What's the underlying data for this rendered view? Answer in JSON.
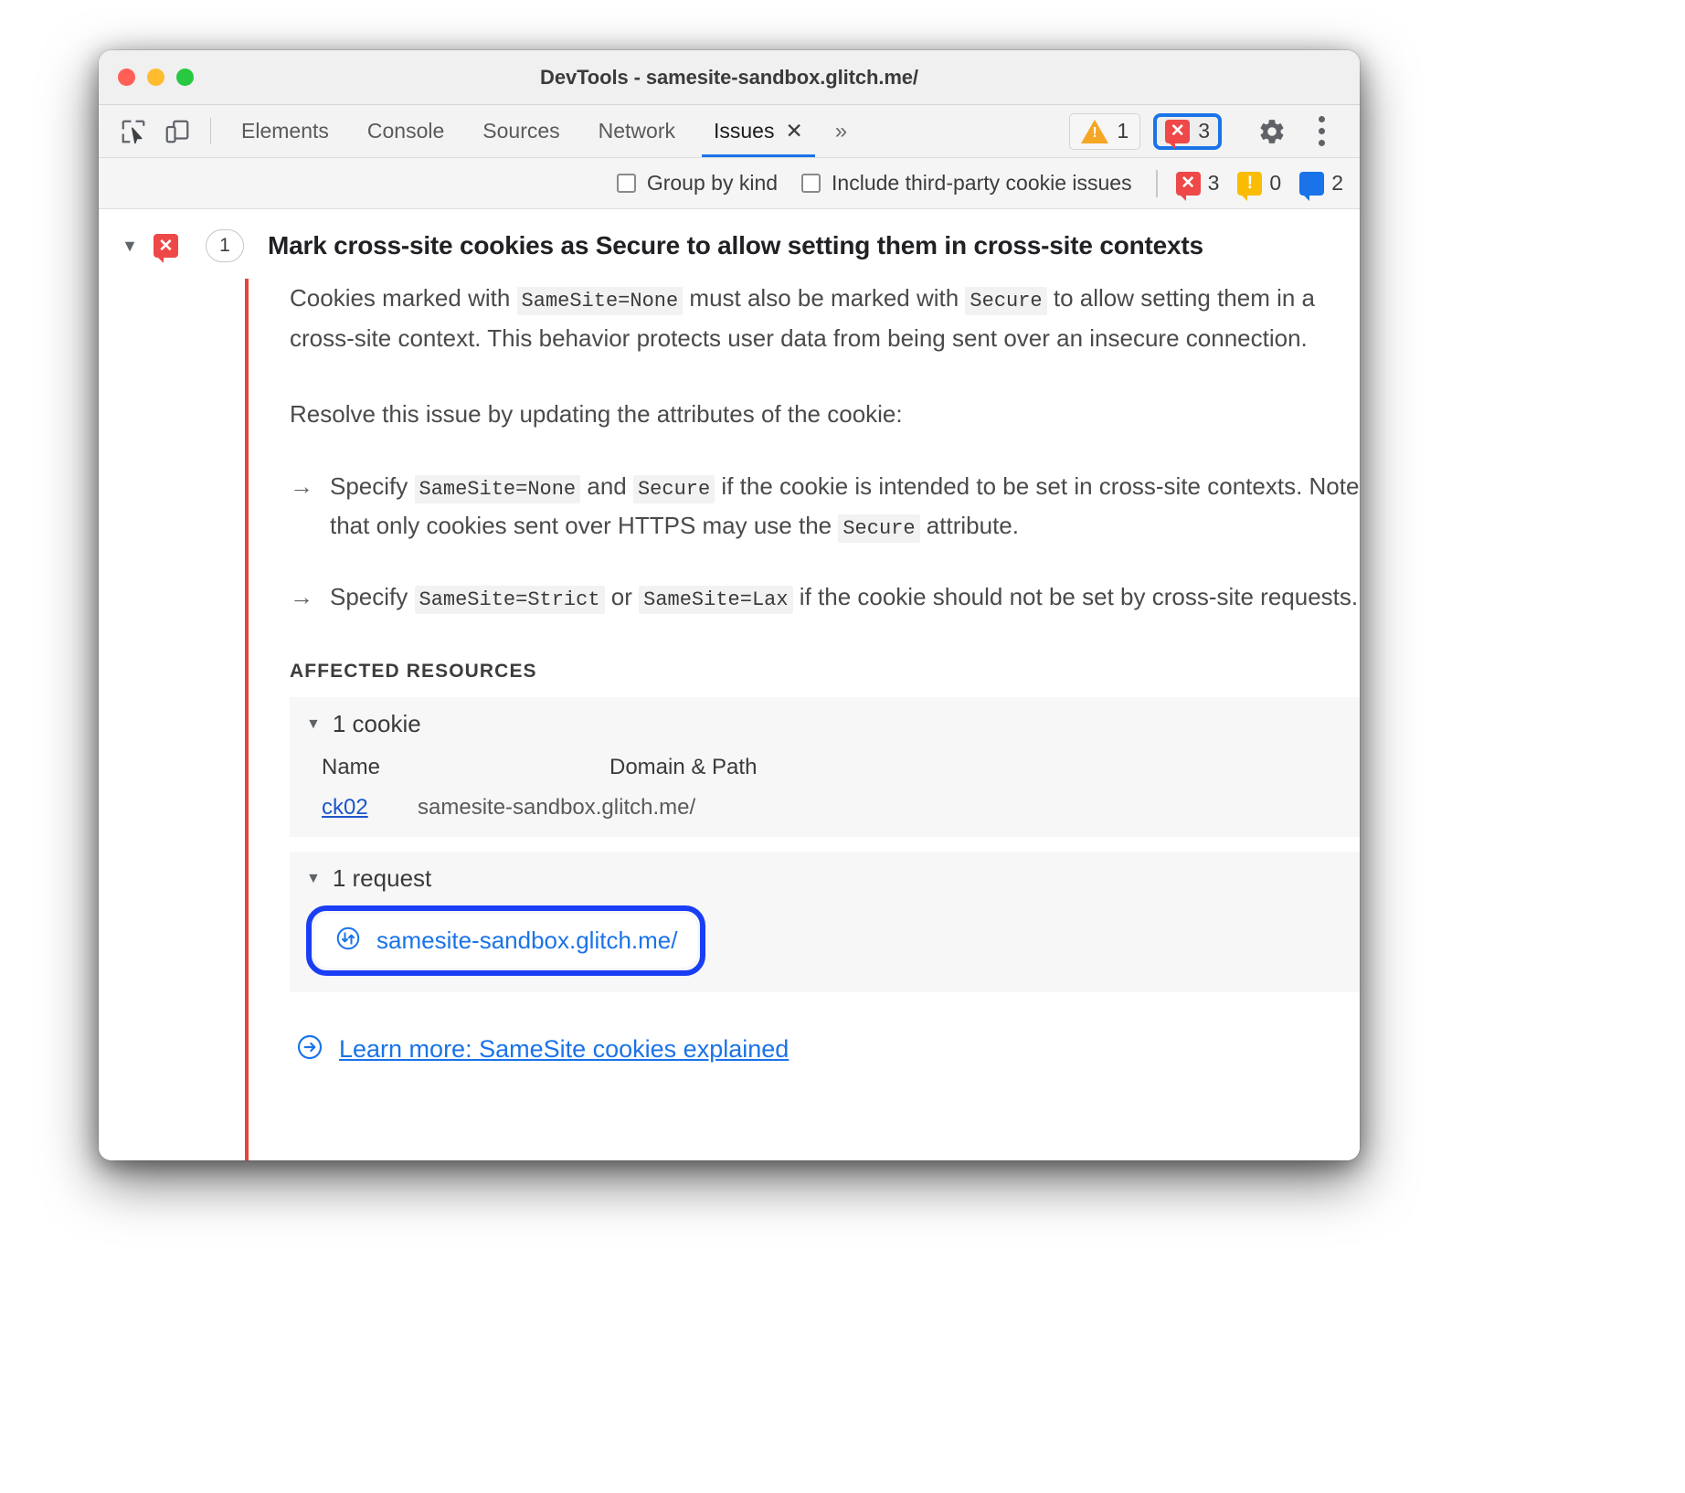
{
  "window": {
    "title": "DevTools - samesite-sandbox.glitch.me/",
    "traffic_lights": [
      "close",
      "minimize",
      "zoom"
    ]
  },
  "toolbar": {
    "inspect_icon": "inspect-element-icon",
    "device_icon": "device-toolbar-icon",
    "tabs": [
      {
        "label": "Elements",
        "active": false,
        "closable": false
      },
      {
        "label": "Console",
        "active": false,
        "closable": false
      },
      {
        "label": "Sources",
        "active": false,
        "closable": false
      },
      {
        "label": "Network",
        "active": false,
        "closable": false
      },
      {
        "label": "Issues",
        "active": true,
        "closable": true
      }
    ],
    "close_tab_glyph": "✕",
    "more_tabs_glyph": "»",
    "warning_count": "1",
    "error_count": "3",
    "settings_icon": "gear-icon",
    "menu_icon": "kebab-menu-icon"
  },
  "filterbar": {
    "group_by_kind": {
      "label": "Group by kind",
      "checked": false
    },
    "include_third_party": {
      "label": "Include third-party cookie issues",
      "checked": false
    },
    "counts": {
      "errors": "3",
      "warnings": "0",
      "info": "2"
    }
  },
  "issue": {
    "expanded": true,
    "expander_glyph": "▼",
    "count": "1",
    "title": "Mark cross-site cookies as Secure to allow setting them in cross-site contexts",
    "paragraphs": {
      "p1_a": "Cookies marked with ",
      "p1_code1": "SameSite=None",
      "p1_b": " must also be marked with ",
      "p1_code2": "Secure",
      "p1_c": " to allow setting them in a cross-site context. This behavior protects user data from being sent over an insecure connection.",
      "p2": "Resolve this issue by updating the attributes of the cookie:"
    },
    "bullets": [
      {
        "arrow": "→",
        "a": "Specify ",
        "code1": "SameSite=None",
        "b": " and ",
        "code2": "Secure",
        "c": " if the cookie is intended to be set in cross-site contexts. Note that only cookies sent over HTTPS may use the ",
        "code3": "Secure",
        "d": " attribute."
      },
      {
        "arrow": "→",
        "a": "Specify ",
        "code1": "SameSite=Strict",
        "b": " or ",
        "code2": "SameSite=Lax",
        "c": " if the cookie should not be set by cross-site requests.",
        "code3": "",
        "d": ""
      }
    ],
    "affected_resources_label": "AFFECTED RESOURCES",
    "cookie_group": {
      "caret": "▼",
      "title": "1 cookie",
      "columns": [
        "Name",
        "Domain & Path"
      ],
      "rows": [
        {
          "name": "ck02",
          "domain_path": "samesite-sandbox.glitch.me/"
        }
      ]
    },
    "request_group": {
      "caret": "▼",
      "title": "1 request",
      "icon": "network-request-icon",
      "url": "samesite-sandbox.glitch.me/",
      "focused": true
    },
    "learn_more": {
      "icon": "arrow-in-circle-icon",
      "label": "Learn more: SameSite cookies explained"
    }
  },
  "colors": {
    "error_red": "#ee4848",
    "issue_bar_red": "#e8433d",
    "warning_orange": "#f5a623",
    "info_blue": "#1a73e8",
    "focus_ring_blue": "#1a3ef5",
    "link_blue": "#1a56c9"
  }
}
